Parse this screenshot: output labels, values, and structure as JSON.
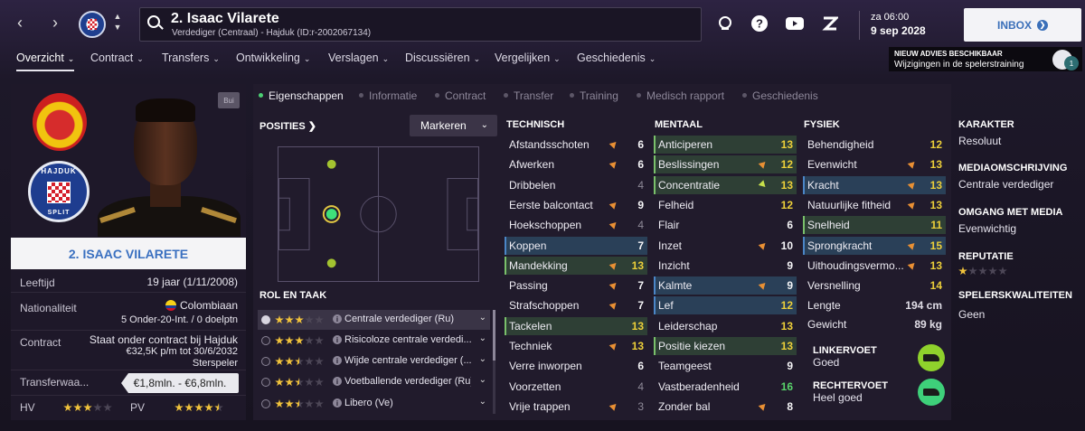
{
  "header": {
    "player_title": "2. Isaac Vilarete",
    "player_sub": "Verdediger (Centraal) - Hajduk (ID:r-2002067134)",
    "time": "za 06:00",
    "date": "9 sep 2028",
    "inbox_label": "INBOX"
  },
  "nav": [
    {
      "label": "Overzicht"
    },
    {
      "label": "Contract"
    },
    {
      "label": "Transfers"
    },
    {
      "label": "Ontwikkeling"
    },
    {
      "label": "Verslagen"
    },
    {
      "label": "Discussiëren"
    },
    {
      "label": "Vergelijken"
    },
    {
      "label": "Geschiedenis"
    }
  ],
  "advice": {
    "title": "NIEUW ADVIES BESCHIKBAAR",
    "text": "Wijzigingen in de spelerstraining",
    "count": "1"
  },
  "subtabs": [
    "Eigenschappen",
    "Informatie",
    "Contract",
    "Transfer",
    "Training",
    "Medisch rapport",
    "Geschiedenis"
  ],
  "profile": {
    "badge": "Bui",
    "name_banner": "2. ISAAC VILARETE",
    "fed_name": "FEDERACION COLOMBIANA DE FUTBOL",
    "club_top": "HAJDUK",
    "club_bottom": "SPLIT",
    "age_label": "Leeftijd",
    "age_value": "19 jaar (1/11/2008)",
    "nat_label": "Nationaliteit",
    "nat_value": "Colombiaan",
    "nat_caps": "5 Onder-20-Int. / 0 doelptn",
    "contract_label": "Contract",
    "contract_line1": "Staat onder contract bij Hajduk",
    "contract_line2": "€32,5K p/m tot 30/6/2032",
    "contract_line3": "Sterspeler",
    "transfer_label": "Transferwaa...",
    "transfer_value": "€1,8mln. - €6,8mln.",
    "hv_label": "HV",
    "hv_stars": 3,
    "pv_label": "PV",
    "pv_stars": 4.5
  },
  "positions": {
    "label": "POSITIES",
    "select": "Markeren"
  },
  "roles": {
    "label": "ROL EN TAAK",
    "items": [
      {
        "name": "Centrale verdediger (Ru)",
        "stars": 3
      },
      {
        "name": "Risicoloze centrale verdedi...",
        "stars": 3
      },
      {
        "name": "Wijde centrale verdediger (...",
        "stars": 2.5
      },
      {
        "name": "Voetballende verdediger (Ru)",
        "stars": 2.5
      },
      {
        "name": "Libero (Ve)",
        "stars": 2.5
      }
    ]
  },
  "technical": {
    "title": "TECHNISCH",
    "items": [
      {
        "n": "Afstandsschoten",
        "v": "6",
        "arrow": "up"
      },
      {
        "n": "Afwerken",
        "v": "6",
        "arrow": "up"
      },
      {
        "n": "Dribbelen",
        "v": "4",
        "arrow": ""
      },
      {
        "n": "Eerste balcontact",
        "v": "9",
        "arrow": "up"
      },
      {
        "n": "Hoekschoppen",
        "v": "4",
        "arrow": "up"
      },
      {
        "n": "Koppen",
        "v": "7",
        "arrow": "",
        "hl": "b"
      },
      {
        "n": "Mandekking",
        "v": "13",
        "arrow": "up",
        "hl": "g"
      },
      {
        "n": "Passing",
        "v": "7",
        "arrow": "up"
      },
      {
        "n": "Strafschoppen",
        "v": "7",
        "arrow": "up"
      },
      {
        "n": "Tackelen",
        "v": "13",
        "arrow": "",
        "hl": "g"
      },
      {
        "n": "Techniek",
        "v": "13",
        "arrow": "up"
      },
      {
        "n": "Verre inworpen",
        "v": "6",
        "arrow": ""
      },
      {
        "n": "Voorzetten",
        "v": "4",
        "arrow": ""
      },
      {
        "n": "Vrije trappen",
        "v": "3",
        "arrow": "up"
      }
    ]
  },
  "mental": {
    "title": "MENTAAL",
    "items": [
      {
        "n": "Anticiperen",
        "v": "13",
        "arrow": "",
        "hl": "g"
      },
      {
        "n": "Beslissingen",
        "v": "12",
        "arrow": "up",
        "hl": "g"
      },
      {
        "n": "Concentratie",
        "v": "13",
        "arrow": "down",
        "hl": "g"
      },
      {
        "n": "Felheid",
        "v": "12",
        "arrow": ""
      },
      {
        "n": "Flair",
        "v": "6",
        "arrow": ""
      },
      {
        "n": "Inzet",
        "v": "10",
        "arrow": "up"
      },
      {
        "n": "Inzicht",
        "v": "9",
        "arrow": ""
      },
      {
        "n": "Kalmte",
        "v": "9",
        "arrow": "up",
        "hl": "b"
      },
      {
        "n": "Lef",
        "v": "12",
        "arrow": "",
        "hl": "b"
      },
      {
        "n": "Leiderschap",
        "v": "13",
        "arrow": ""
      },
      {
        "n": "Positie kiezen",
        "v": "13",
        "arrow": "",
        "hl": "g"
      },
      {
        "n": "Teamgeest",
        "v": "9",
        "arrow": ""
      },
      {
        "n": "Vastberadenheid",
        "v": "16",
        "arrow": ""
      },
      {
        "n": "Zonder bal",
        "v": "8",
        "arrow": "up"
      }
    ]
  },
  "physical": {
    "title": "FYSIEK",
    "items": [
      {
        "n": "Behendigheid",
        "v": "12",
        "arrow": ""
      },
      {
        "n": "Evenwicht",
        "v": "13",
        "arrow": "up"
      },
      {
        "n": "Kracht",
        "v": "13",
        "arrow": "up",
        "hl": "b"
      },
      {
        "n": "Natuurlijke fitheid",
        "v": "13",
        "arrow": "up"
      },
      {
        "n": "Snelheid",
        "v": "11",
        "arrow": "",
        "hl": "g"
      },
      {
        "n": "Sprongkracht",
        "v": "15",
        "arrow": "up",
        "hl": "b"
      },
      {
        "n": "Uithoudingsvermo...",
        "v": "13",
        "arrow": "up"
      },
      {
        "n": "Versnelling",
        "v": "14",
        "arrow": ""
      }
    ],
    "length_label": "Lengte",
    "length_value": "194 cm",
    "weight_label": "Gewicht",
    "weight_value": "89 kg",
    "left_foot_label": "LINKERVOET",
    "left_foot_value": "Goed",
    "right_foot_label": "RECHTERVOET",
    "right_foot_value": "Heel goed"
  },
  "right_info": {
    "karakter_label": "KARAKTER",
    "karakter_value": "Resoluut",
    "media_label": "MEDIAOMSCHRIJVING",
    "media_value": "Centrale verdediger",
    "omgang_label": "OMGANG MET MEDIA",
    "omgang_value": "Evenwichtig",
    "reputatie_label": "REPUTATIE",
    "reputatie_stars": 1,
    "kwaliteiten_label": "SPELERSKWALITEITEN",
    "kwaliteiten_value": "Geen"
  }
}
